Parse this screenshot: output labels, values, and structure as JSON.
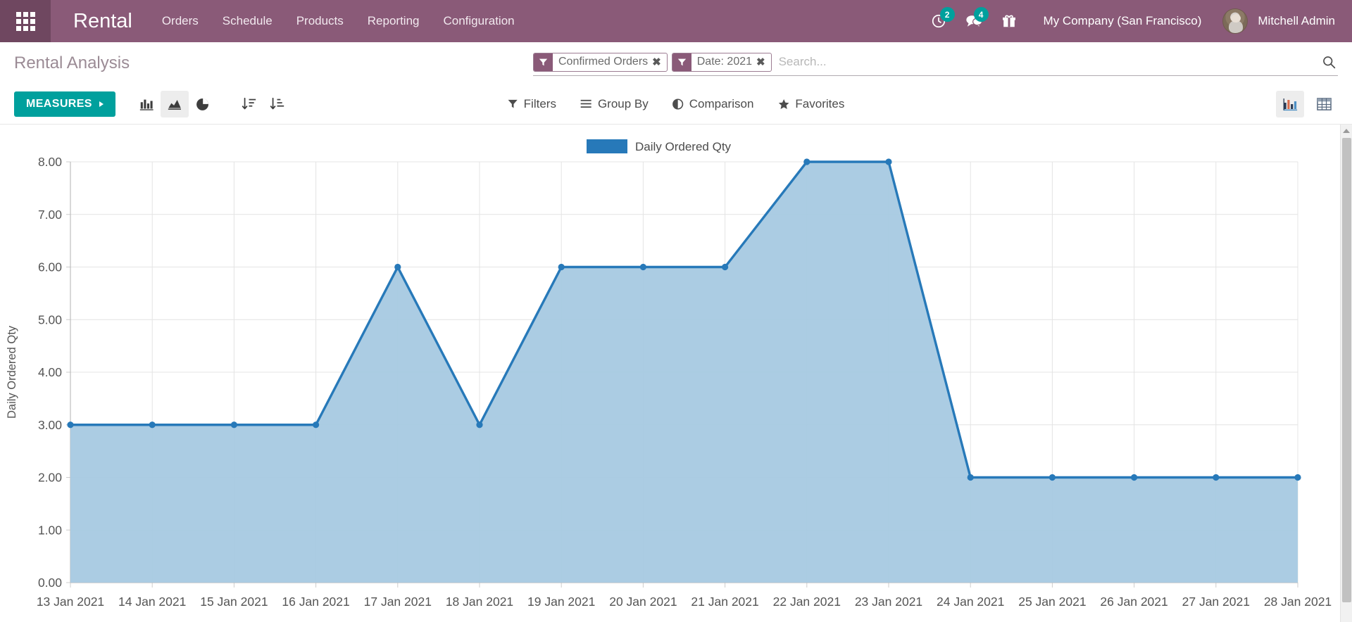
{
  "navbar": {
    "apps_icon": "apps-grid-icon",
    "brand": "Rental",
    "menu": [
      {
        "label": "Orders"
      },
      {
        "label": "Schedule"
      },
      {
        "label": "Products"
      },
      {
        "label": "Reporting"
      },
      {
        "label": "Configuration"
      }
    ],
    "activities": {
      "icon": "clock-icon",
      "count": "2"
    },
    "messages": {
      "icon": "messages-icon",
      "count": "4"
    },
    "gift": {
      "icon": "gift-icon"
    },
    "company": "My Company (San Francisco)",
    "user": "Mitchell Admin",
    "accent_color": "#8a5a78",
    "badge_color": "#00a09d"
  },
  "control_panel": {
    "breadcrumb": "Rental Analysis",
    "search": {
      "placeholder": "Search...",
      "value": "",
      "facets": [
        {
          "icon": "filter-funnel-icon",
          "label": "Confirmed Orders",
          "remove": "✖"
        },
        {
          "icon": "filter-funnel-icon",
          "label": "Date: 2021",
          "remove": "✖"
        }
      ]
    },
    "measures_label": "MEASURES",
    "chart_type_buttons": [
      {
        "name": "bar-chart-icon",
        "label": "Bar Chart",
        "active": false
      },
      {
        "name": "line-chart-icon",
        "label": "Line Chart",
        "active": true
      },
      {
        "name": "pie-chart-icon",
        "label": "Pie Chart",
        "active": false
      }
    ],
    "sort_buttons": [
      {
        "name": "sort-descending-icon",
        "label": "Descending"
      },
      {
        "name": "sort-ascending-icon",
        "label": "Ascending"
      }
    ],
    "dropdowns": [
      {
        "icon": "filter-funnel-icon",
        "label": "Filters"
      },
      {
        "icon": "group-by-icon",
        "label": "Group By"
      },
      {
        "icon": "comparison-icon",
        "label": "Comparison"
      },
      {
        "icon": "star-icon",
        "label": "Favorites"
      }
    ],
    "view_switcher": [
      {
        "name": "graph-view-icon",
        "label": "Graph",
        "active": true
      },
      {
        "name": "pivot-view-icon",
        "label": "Pivot",
        "active": false
      }
    ]
  },
  "chart_data": {
    "type": "area",
    "title": "",
    "xlabel": "",
    "ylabel": "Daily Ordered Qty",
    "legend": [
      {
        "label": "Daily Ordered Qty",
        "color": "#2779b9"
      }
    ],
    "legend_position": "top",
    "grid": true,
    "ylim": [
      0,
      8
    ],
    "ytick_labels": [
      "0.00",
      "1.00",
      "2.00",
      "3.00",
      "4.00",
      "5.00",
      "6.00",
      "7.00",
      "8.00"
    ],
    "ytick_values": [
      0,
      1,
      2,
      3,
      4,
      5,
      6,
      7,
      8
    ],
    "categories": [
      "13 Jan 2021",
      "14 Jan 2021",
      "15 Jan 2021",
      "16 Jan 2021",
      "17 Jan 2021",
      "18 Jan 2021",
      "19 Jan 2021",
      "20 Jan 2021",
      "21 Jan 2021",
      "22 Jan 2021",
      "23 Jan 2021",
      "24 Jan 2021",
      "25 Jan 2021",
      "26 Jan 2021",
      "27 Jan 2021",
      "28 Jan 2021"
    ],
    "series": [
      {
        "name": "Daily Ordered Qty",
        "color": "#2779b9",
        "fill_color": "#a6c9e2",
        "values": [
          3,
          3,
          3,
          3,
          6,
          3,
          6,
          6,
          6,
          8,
          8,
          2,
          2,
          2,
          2,
          2
        ]
      }
    ]
  }
}
